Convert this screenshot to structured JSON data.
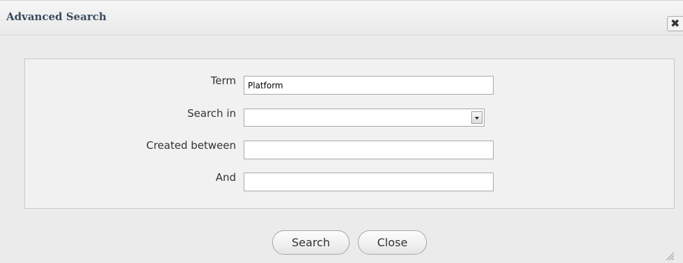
{
  "dialog": {
    "title": "Advanced Search",
    "close_icon_glyph": "✖",
    "resize_icon": "resize-grip-icon"
  },
  "form": {
    "term": {
      "label": "Term",
      "value": "Platform",
      "placeholder": ""
    },
    "search_in": {
      "label": "Search in",
      "selected": ""
    },
    "created_between": {
      "label": "Created between",
      "value": "",
      "placeholder": ""
    },
    "and": {
      "label": "And",
      "value": "",
      "placeholder": ""
    }
  },
  "buttons": {
    "search_label": "Search",
    "close_label": "Close"
  },
  "colors": {
    "title_text": "#3a4a5c",
    "dialog_bg": "#ebebeb",
    "panel_bg": "#f1f1f1"
  }
}
